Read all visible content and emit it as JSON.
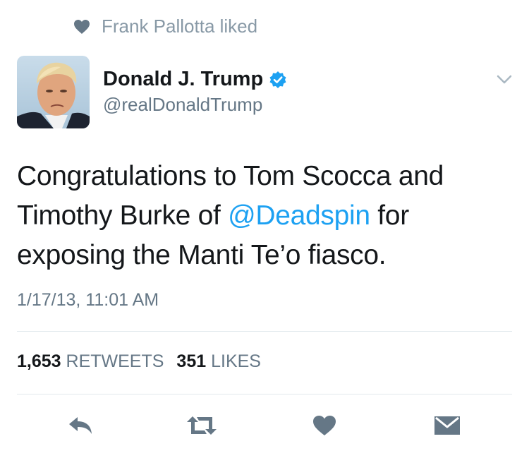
{
  "social_context": {
    "text": "Frank Pallotta liked",
    "icon": "heart-icon"
  },
  "author": {
    "display_name": "Donald J. Trump",
    "handle": "@realDonaldTrump",
    "verified": true
  },
  "tweet": {
    "text_parts": [
      "Congratulations to Tom Scocca and Timothy Burke of ",
      "@Deadspin",
      " for exposing the Manti Te’o fiasco."
    ],
    "timestamp": "1/17/13, 11:01 AM"
  },
  "stats": {
    "retweets_count": "1,653",
    "retweets_label": "RETWEETS",
    "likes_count": "351",
    "likes_label": "LIKES"
  },
  "actions": [
    "reply-icon",
    "retweet-icon",
    "like-icon",
    "message-icon"
  ],
  "colors": {
    "accent": "#1da1f2",
    "icon_gray": "#657786",
    "muted": "#8899a6",
    "divider": "#e1e8ed"
  }
}
